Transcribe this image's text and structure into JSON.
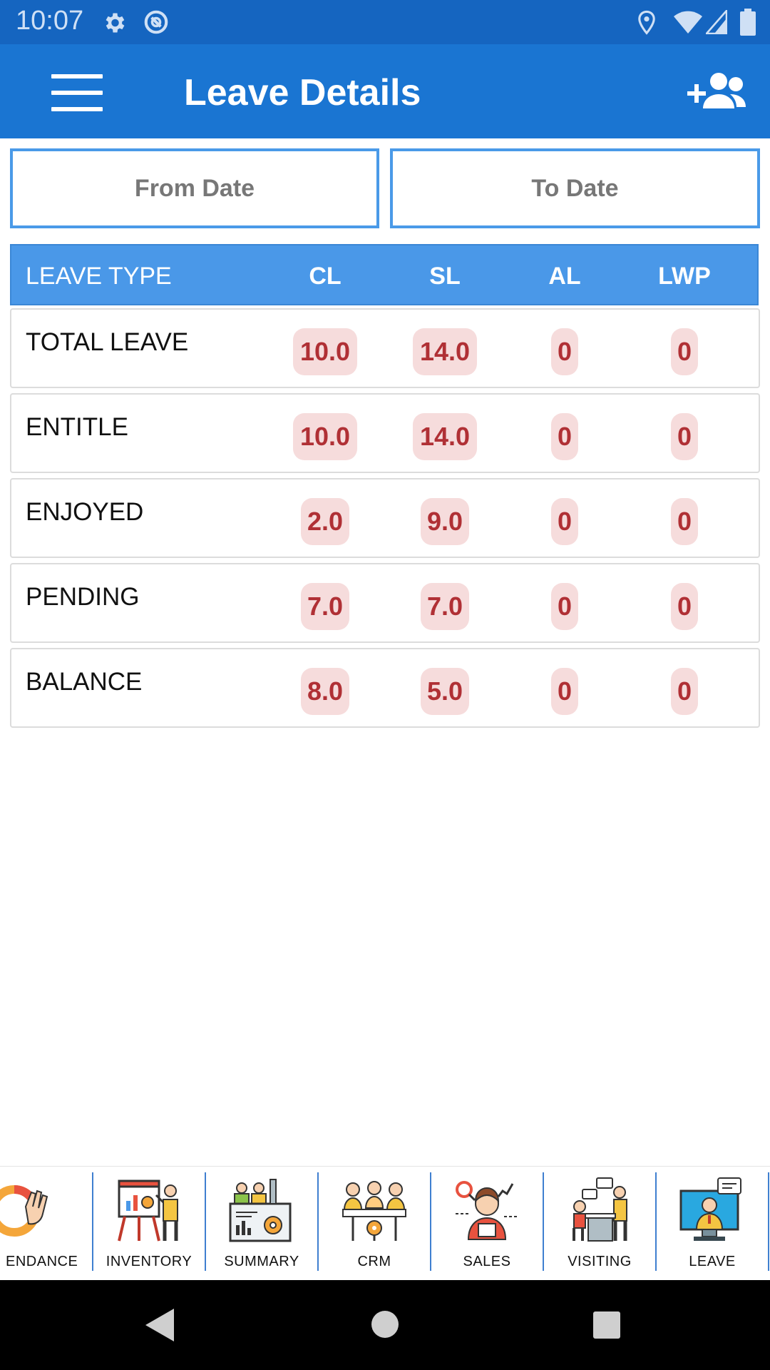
{
  "status_bar": {
    "time": "10:07",
    "icons": [
      "settings-icon",
      "sync-icon",
      "location-icon",
      "wifi-icon",
      "signal-icon",
      "battery-icon"
    ]
  },
  "app_bar": {
    "title": "Leave Details",
    "menu_icon": "hamburger-menu-icon",
    "action_icon": "add-user-icon"
  },
  "filters": {
    "from_date": "From Date",
    "to_date": "To Date"
  },
  "table": {
    "headers": [
      "LEAVE TYPE",
      "CL",
      "SL",
      "AL",
      "LWP"
    ],
    "rows": [
      {
        "label": "TOTAL LEAVE",
        "cl": "10.0",
        "sl": "14.0",
        "al": "0",
        "lwp": "0"
      },
      {
        "label": "ENTITLE",
        "cl": "10.0",
        "sl": "14.0",
        "al": "0",
        "lwp": "0"
      },
      {
        "label": "ENJOYED",
        "cl": "2.0",
        "sl": "9.0",
        "al": "0",
        "lwp": "0"
      },
      {
        "label": "PENDING",
        "cl": "7.0",
        "sl": "7.0",
        "al": "0",
        "lwp": "0"
      },
      {
        "label": "BALANCE",
        "cl": "8.0",
        "sl": "5.0",
        "al": "0",
        "lwp": "0"
      }
    ]
  },
  "bottom_nav": {
    "items": [
      {
        "label": "ENDANCE",
        "icon": "attendance-icon"
      },
      {
        "label": "INVENTORY",
        "icon": "inventory-icon"
      },
      {
        "label": "SUMMARY",
        "icon": "summary-icon"
      },
      {
        "label": "CRM",
        "icon": "crm-icon"
      },
      {
        "label": "SALES",
        "icon": "sales-icon"
      },
      {
        "label": "VISITING",
        "icon": "visiting-icon"
      },
      {
        "label": "LEAVE",
        "icon": "leave-icon"
      }
    ]
  },
  "system_nav": [
    "back-icon",
    "home-icon",
    "recents-icon"
  ],
  "colors": {
    "status_bar": "#1565c0",
    "app_bar": "#1a75d2",
    "table_header": "#4a98e8",
    "pill_bg": "#f6dcdc",
    "pill_text": "#b03035"
  }
}
